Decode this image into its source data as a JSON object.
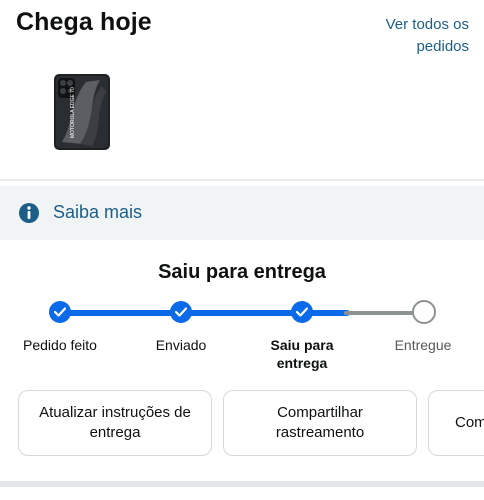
{
  "header": {
    "title": "Chega hoje",
    "all_orders_link": "Ver todos os pedidos"
  },
  "product": {
    "image_alt": "Motorola Edge 70 smartphone",
    "device_text": "MOTOROLA EDGE 70"
  },
  "info_bar": {
    "label": "Saiba mais",
    "icon": "info-icon"
  },
  "tracking": {
    "status_title": "Saiu para entrega",
    "progress_fraction": 0.85,
    "steps": [
      {
        "label": "Pedido feito",
        "state": "done"
      },
      {
        "label": "Enviado",
        "state": "done"
      },
      {
        "label": "Saiu para entrega",
        "state": "current"
      },
      {
        "label": "Entregue",
        "state": "pending"
      }
    ]
  },
  "actions": [
    {
      "label": "Atualizar instruções de entrega"
    },
    {
      "label": "Compartilhar rastreamento"
    },
    {
      "label": "Com"
    }
  ],
  "colors": {
    "accent": "#0a6ae8",
    "link": "#1d5e89",
    "info_bg": "#f0f4f5"
  }
}
